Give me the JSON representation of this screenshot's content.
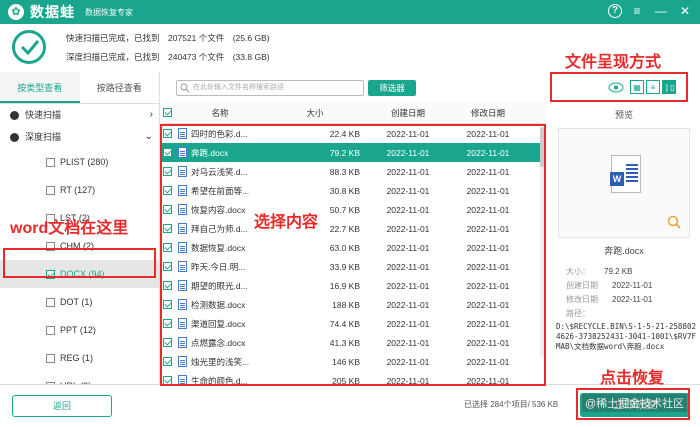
{
  "app": {
    "name": "数据蛙",
    "subtitle": "数据恢复专家",
    "logo_glyph": "✿"
  },
  "window": {
    "help": "?",
    "menu": "≡",
    "minimize": "—",
    "close": "✕"
  },
  "summary": {
    "quick_scan": "快速扫描已完成，已找到　207521 个文件　(25.6 GB)",
    "deep_scan": "深度扫描已完成，已找到　240473 个文件　(33.8 GB)"
  },
  "sidebar": {
    "tabs": [
      "按类型查看",
      "按路径查看"
    ],
    "quick_scan_label": "快速扫描",
    "deep_scan_label": "深度扫描",
    "types": [
      {
        "label": "PLIST (280)",
        "checked": false
      },
      {
        "label": "RT (127)",
        "checked": false
      },
      {
        "label": "LST (2)",
        "checked": false
      },
      {
        "label": "CHM (2)",
        "checked": false
      },
      {
        "label": "DOCX (94)",
        "checked": true
      },
      {
        "label": "DOT (1)",
        "checked": false
      },
      {
        "label": "PPT (12)",
        "checked": false
      },
      {
        "label": "REG (1)",
        "checked": false
      },
      {
        "label": "URL (3)",
        "checked": false
      }
    ]
  },
  "search": {
    "placeholder": "在此处输入文件名称搜索路径"
  },
  "filter_label": "筛选器",
  "table": {
    "columns": [
      "名称",
      "大小",
      "创建日期",
      "修改日期"
    ],
    "rows": [
      {
        "name": "四时的色彩.d...",
        "size": "22.4 KB",
        "created": "2022-11-01",
        "modified": "2022-11-01",
        "selected": false
      },
      {
        "name": "奔跑.docx",
        "size": "79.2 KB",
        "created": "2022-11-01",
        "modified": "2022-11-01",
        "selected": true
      },
      {
        "name": "对乌云浅笑.d...",
        "size": "88.3 KB",
        "created": "2022-11-01",
        "modified": "2022-11-01",
        "selected": false
      },
      {
        "name": "希望在前面等...",
        "size": "30.8 KB",
        "created": "2022-11-01",
        "modified": "2022-11-01",
        "selected": false
      },
      {
        "name": "恢复内容.docx",
        "size": "50.7 KB",
        "created": "2022-11-01",
        "modified": "2022-11-01",
        "selected": false
      },
      {
        "name": "拜自己为师.d...",
        "size": "22.7 KB",
        "created": "2022-11-01",
        "modified": "2022-11-01",
        "selected": false
      },
      {
        "name": "数据恢复.docx",
        "size": "63.0 KB",
        "created": "2022-11-01",
        "modified": "2022-11-01",
        "selected": false
      },
      {
        "name": "昨天.今日.明...",
        "size": "33.9 KB",
        "created": "2022-11-01",
        "modified": "2022-11-01",
        "selected": false
      },
      {
        "name": "期望的眼光.d...",
        "size": "16.9 KB",
        "created": "2022-11-01",
        "modified": "2022-11-01",
        "selected": false
      },
      {
        "name": "检测数据.docx",
        "size": "188 KB",
        "created": "2022-11-01",
        "modified": "2022-11-01",
        "selected": false
      },
      {
        "name": "渠道回复.docx",
        "size": "74.4 KB",
        "created": "2022-11-01",
        "modified": "2022-11-01",
        "selected": false
      },
      {
        "name": "点燃露念.docx",
        "size": "41.3 KB",
        "created": "2022-11-01",
        "modified": "2022-11-01",
        "selected": false
      },
      {
        "name": "烛光里的浅笑...",
        "size": "146 KB",
        "created": "2022-11-01",
        "modified": "2022-11-01",
        "selected": false
      },
      {
        "name": "生命的颜色.d...",
        "size": "205 KB",
        "created": "2022-11-01",
        "modified": "2022-11-01",
        "selected": false
      }
    ]
  },
  "preview": {
    "title": "预览",
    "file_name": "奔跑.docx",
    "size_label": "大小：",
    "size_value": "79.2 KB",
    "created_label": "创建日期",
    "created_value": "2022-11-01",
    "modified_label": "修改日期",
    "modified_value": "2022-11-01",
    "path_label": "路径：",
    "path_value": "D:\\$RECYCLE.BIN\\S-1-5-21-2588024626-3738252431-3041-1001\\$RV7FMAB\\文档数据word\\奔跑.docx",
    "doc_glyph": "W"
  },
  "footer": {
    "back_label": "返回",
    "selection_status": "已选择 284个项目/ 536 KB",
    "recover_label": "立即恢复"
  },
  "annotations": {
    "view_mode": "文件呈现方式",
    "word_here": "word文档在这里",
    "select_content": "选择内容",
    "click_recover": "点击恢复",
    "watermark": "@稀土掘金技术社区"
  },
  "colors": {
    "accent": "#1aa68e",
    "annotation": "#e52b2b"
  }
}
